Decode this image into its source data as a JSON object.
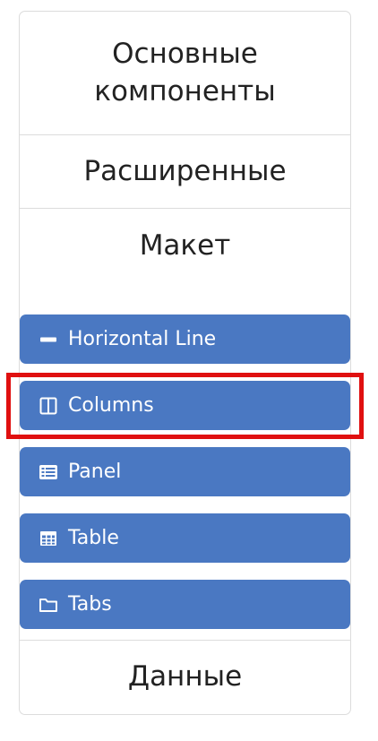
{
  "sidebar": {
    "sections": {
      "basic": "Основные компоненты",
      "advanced": "Расширенные",
      "layout": "Макет",
      "data": "Данные"
    },
    "layout_items": [
      {
        "label": "Horizontal Line",
        "icon": "minus-icon"
      },
      {
        "label": "Columns",
        "icon": "columns-icon"
      },
      {
        "label": "Panel",
        "icon": "list-alt-icon"
      },
      {
        "label": "Table",
        "icon": "table-icon"
      },
      {
        "label": "Tabs",
        "icon": "folder-icon"
      }
    ]
  },
  "colors": {
    "button_bg": "#4a78c2",
    "highlight": "#e01010"
  },
  "highlighted_item": "Columns"
}
